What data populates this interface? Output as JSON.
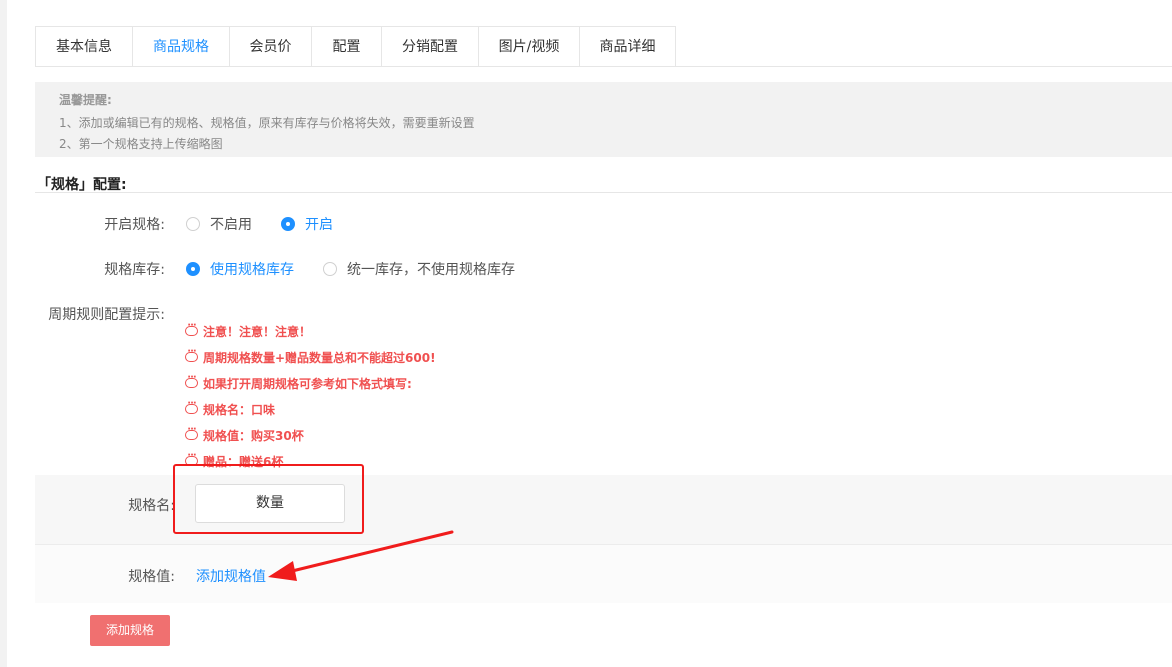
{
  "tabs": [
    {
      "label": "基本信息",
      "active": false
    },
    {
      "label": "商品规格",
      "active": true
    },
    {
      "label": "会员价",
      "active": false
    },
    {
      "label": "配置",
      "active": false
    },
    {
      "label": "分销配置",
      "active": false
    },
    {
      "label": "图片/视频",
      "active": false
    },
    {
      "label": "商品详细",
      "active": false
    }
  ],
  "notice": {
    "title": "温馨提醒:",
    "line1": "1、添加或编辑已有的规格、规格值，原来有库存与价格将失效，需要重新设置",
    "line2": "2、第一个规格支持上传缩略图"
  },
  "section_title": "「规格」配置:",
  "enable_spec": {
    "label": "开启规格:",
    "option_off": "不启用",
    "option_on": "开启",
    "selected": "开启"
  },
  "spec_stock": {
    "label": "规格库存:",
    "option_spec": "使用规格库存",
    "option_unified": "统一库存，不使用规格库存",
    "selected": "使用规格库存"
  },
  "cycle_hint": {
    "label": "周期规则配置提示:",
    "tips": [
      "注意！注意！注意！",
      "周期规格数量+赠品数量总和不能超过600!",
      "如果打开周期规格可参考如下格式填写:",
      "规格名：口味",
      "规格值：购买30杯",
      "赠品：赠送6杯"
    ]
  },
  "spec_name": {
    "label": "规格名:",
    "value": "数量"
  },
  "spec_value": {
    "label": "规格值:",
    "add_link": "添加规格值"
  },
  "add_spec_button": "添加规格",
  "colors": {
    "accent": "#1e90ff",
    "warning": "#f05050",
    "annotation": "#f01c1c",
    "button": "#f07070"
  }
}
